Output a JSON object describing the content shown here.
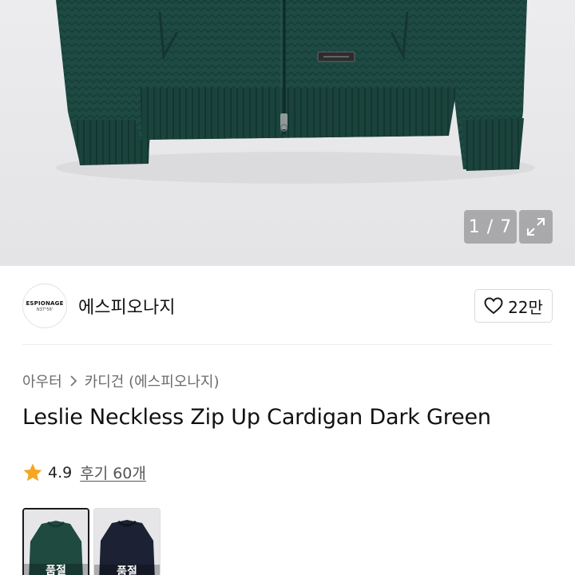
{
  "gallery": {
    "counter": "1 / 7",
    "icons": {
      "expand": "expand-icon"
    }
  },
  "brand": {
    "logo_line1": "ESPIONAGE",
    "logo_line2": "N37°56'",
    "name": "에스피오나지",
    "like_count": "22만",
    "icons": {
      "like": "heart-outline-icon"
    }
  },
  "breadcrumb": {
    "category": "아우터",
    "subcategory": "카디건 (에스피오나지)",
    "icons": {
      "separator": "chevron-right-icon"
    }
  },
  "product": {
    "title": "Leslie Neckless Zip Up Cardigan Dark Green"
  },
  "rating": {
    "score": "4.9",
    "reviews_label": "후기 60개",
    "icons": {
      "star": "star-icon"
    },
    "star_color": "#f5a623"
  },
  "variants": [
    {
      "tag": "품절",
      "color": "#1f4a40",
      "selected": true
    },
    {
      "tag": "품절",
      "color": "#1c2233",
      "selected": false
    }
  ],
  "colors": {
    "sweater_green": "#1d4a42",
    "sweater_navy": "#1c2233",
    "hero_background": "#e9e9eb"
  }
}
